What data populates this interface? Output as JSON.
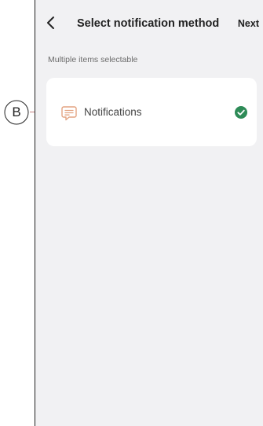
{
  "header": {
    "back_icon": "chevron-left-icon",
    "title": "Select notification method",
    "next_label": "Next"
  },
  "hint": "Multiple items selectable",
  "items": [
    {
      "icon": "chat-bubble-icon",
      "label": "Notifications",
      "selected": true,
      "check_icon": "check-circle-icon"
    }
  ],
  "callout": {
    "letter": "B",
    "color": "#c4807f"
  },
  "colors": {
    "accent_check": "#2e8b57",
    "icon_tint": "#e3a482",
    "background": "#f1f1f3",
    "card": "#ffffff"
  }
}
